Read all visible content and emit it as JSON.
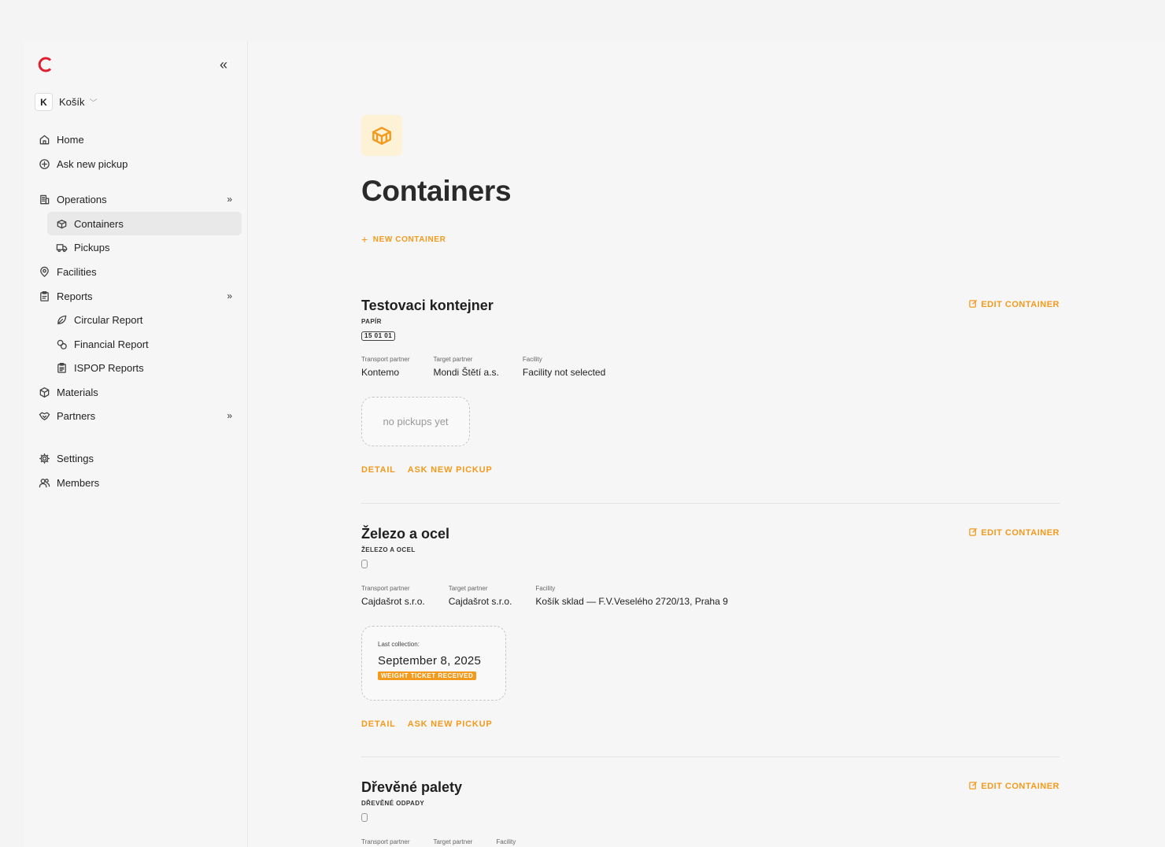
{
  "org": {
    "initial": "K",
    "name": "Košík"
  },
  "nav": {
    "home": "Home",
    "ask_new_pickup": "Ask new pickup",
    "operations": "Operations",
    "containers": "Containers",
    "pickups": "Pickups",
    "facilities": "Facilities",
    "reports": "Reports",
    "circular_report": "Circular Report",
    "financial_report": "Financial Report",
    "ispop_reports": "ISPOP Reports",
    "materials": "Materials",
    "partners": "Partners",
    "settings": "Settings",
    "members": "Members"
  },
  "page": {
    "title": "Containers",
    "new_container": "NEW CONTAINER"
  },
  "labels": {
    "transport_partner": "Transport partner",
    "target_partner": "Target partner",
    "facility": "Facility",
    "edit_container": "EDIT CONTAINER",
    "detail": "DETAIL",
    "ask_new_pickup": "ASK NEW PICKUP",
    "last_collection": "Last collection:"
  },
  "containers": [
    {
      "name": "Testovaci kontejner",
      "material": "PAPÍR",
      "code": "15 01 01",
      "transport_partner": "Kontemo",
      "target_partner": "Mondi Štětí a.s.",
      "facility": "Facility not selected",
      "pickup_placeholder": "no pickups yet"
    },
    {
      "name": "Železo a ocel",
      "material": "ŽELEZO A OCEL",
      "code": "",
      "transport_partner": "Cajdašrot s.r.o.",
      "target_partner": "Cajdašrot s.r.o.",
      "facility": "Košík sklad — F.V.Veselého 2720/13, Praha 9",
      "last_collection_date": "September 8, 2025",
      "status": "WEIGHT TICKET RECEIVED"
    },
    {
      "name": "Dřevěné palety",
      "material": "DŘEVĚNÉ ODPADY",
      "code": ""
    }
  ],
  "colors": {
    "accent": "#f39a1c",
    "logo": "#e0202e",
    "active_nav": "#e9e9e9"
  }
}
